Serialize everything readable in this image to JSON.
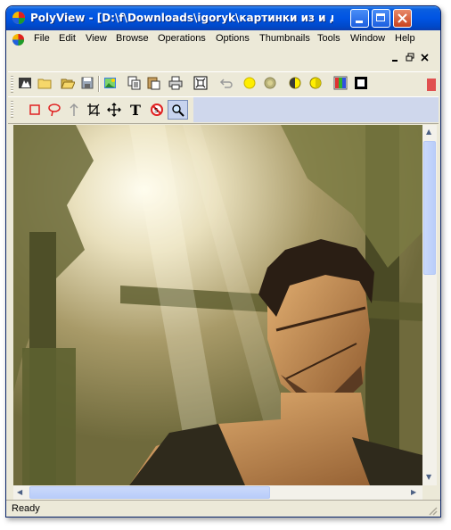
{
  "window": {
    "title": "PolyView - [D:\\f\\Downloads\\igoryk\\картинки из и для са..."
  },
  "menu": [
    "File",
    "Edit",
    "View",
    "Browse",
    "Operations",
    "Options",
    "Thumbnails",
    "Tools",
    "Window",
    "Help"
  ],
  "mdi_controls": [
    "minimize-child",
    "restore-child",
    "close-child"
  ],
  "toolbar1": [
    "open-recent-icon",
    "folder-icon",
    "open-folder-icon",
    "save-icon",
    "image-icon",
    "copy-icon",
    "paste-icon",
    "print-icon",
    "fit-icon",
    "undo-icon",
    "brightness-up-icon",
    "brightness-down-icon",
    "contrast-icon",
    "contrast-down-icon",
    "color-icon",
    "frame-icon"
  ],
  "toolbar2": [
    "rectangle-select-icon",
    "lasso-icon",
    "arrow-icon",
    "crop-icon",
    "move-icon",
    "text-icon",
    "no-icon",
    "zoom-icon"
  ],
  "toolbar2_text_glyph": "T",
  "status": {
    "text": "Ready"
  },
  "colors": {
    "titlebar": "#0054e3",
    "window_bg": "#ece9d8",
    "scroll_thumb": "#c1d3fb"
  }
}
